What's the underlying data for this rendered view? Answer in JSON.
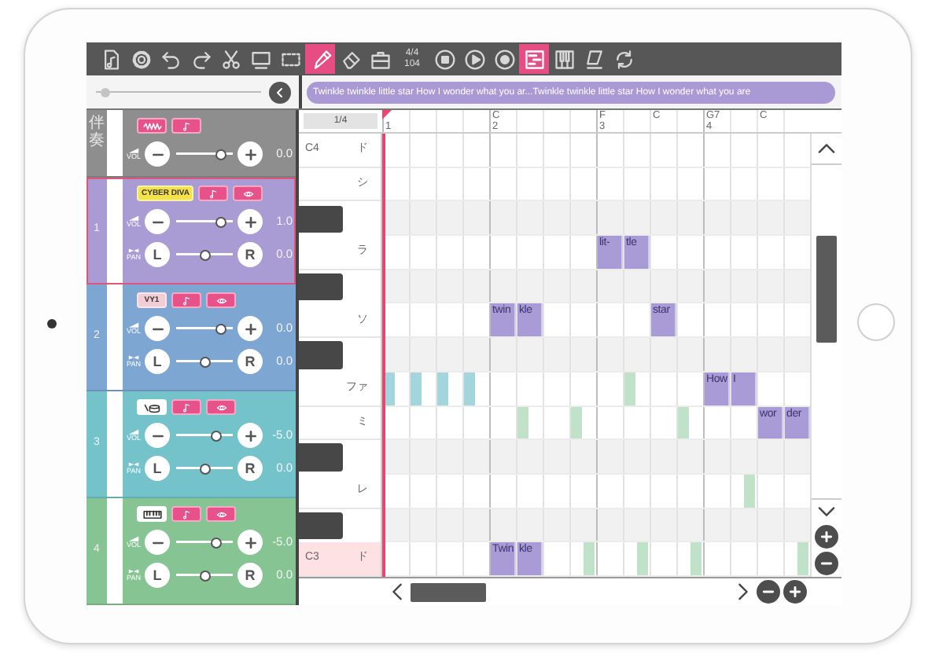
{
  "toolbar": {
    "items": [
      {
        "kind": "file",
        "selected": false
      },
      {
        "kind": "settings",
        "selected": false
      },
      {
        "kind": "undo",
        "selected": false
      },
      {
        "kind": "redo",
        "selected": false
      },
      {
        "kind": "cut",
        "selected": false
      },
      {
        "kind": "select",
        "selected": false
      },
      {
        "kind": "move",
        "selected": false
      },
      {
        "kind": "pencil",
        "selected": true
      },
      {
        "kind": "eraser",
        "selected": false
      },
      {
        "kind": "toolbox",
        "selected": false
      },
      {
        "kind": "tempo",
        "meter": "4/4",
        "tempo": "104"
      },
      {
        "kind": "stop"
      },
      {
        "kind": "play"
      },
      {
        "kind": "record"
      },
      {
        "kind": "pianoroll",
        "selected": true
      },
      {
        "kind": "keyboard",
        "selected": false
      },
      {
        "kind": "score",
        "selected": false
      },
      {
        "kind": "loop",
        "selected": false
      }
    ]
  },
  "zoom_slider": {
    "level": 0.03
  },
  "lyrics": {
    "text": "Twinkle twinkle little star How I wonder what you ar...Twinkle twinkle little star How I wonder what you are"
  },
  "tracks": [
    {
      "label": "伴奏",
      "color": "#8e8e8e",
      "selected": false,
      "badges": [
        {
          "kind": "wave"
        },
        {
          "kind": "note"
        }
      ],
      "controls": [
        {
          "kind": "volume",
          "label": "VOL",
          "level": 0.87,
          "reading": "0.0"
        }
      ]
    },
    {
      "label": "1",
      "color": "#a99bd3",
      "selected": true,
      "badges": [
        {
          "kind": "text",
          "text": "CYBER DIVA",
          "color": "#f3e24c"
        },
        {
          "kind": "note"
        },
        {
          "kind": "eye"
        }
      ],
      "controls": [
        {
          "kind": "volume",
          "label": "VOL",
          "level": 0.87,
          "reading": "1.0"
        },
        {
          "kind": "pan",
          "label": "PAN",
          "left": "L",
          "right": "R",
          "level": 0.5,
          "reading": "0.0"
        }
      ]
    },
    {
      "label": "2",
      "color": "#7ea6d3",
      "selected": false,
      "badges": [
        {
          "kind": "text",
          "text": "VY1",
          "color": "#f3cdd6"
        },
        {
          "kind": "note"
        },
        {
          "kind": "eye"
        }
      ],
      "controls": [
        {
          "kind": "volume",
          "label": "VOL",
          "level": 0.87,
          "reading": "0.0"
        },
        {
          "kind": "pan",
          "label": "PAN",
          "left": "L",
          "right": "R",
          "level": 0.5,
          "reading": "0.0"
        }
      ]
    },
    {
      "label": "3",
      "color": "#74c3cb",
      "selected": false,
      "badges": [
        {
          "kind": "drum"
        },
        {
          "kind": "note"
        },
        {
          "kind": "eye"
        }
      ],
      "controls": [
        {
          "kind": "volume",
          "label": "VOL",
          "level": 0.75,
          "reading": "-5.0"
        },
        {
          "kind": "pan",
          "label": "PAN",
          "left": "L",
          "right": "R",
          "level": 0.5,
          "reading": "0.0"
        }
      ]
    },
    {
      "label": "4",
      "color": "#86c593",
      "selected": false,
      "badges": [
        {
          "kind": "keys"
        },
        {
          "kind": "note"
        },
        {
          "kind": "eye"
        }
      ],
      "controls": [
        {
          "kind": "volume",
          "label": "VOL",
          "level": 0.75,
          "reading": "-5.0"
        },
        {
          "kind": "pan",
          "label": "PAN",
          "left": "L",
          "right": "R",
          "level": 0.5,
          "reading": "0.0"
        }
      ]
    }
  ],
  "editor": {
    "grid_division": "1/4",
    "ruler": [
      {
        "measure": "1"
      },
      {
        "chord": "C",
        "measure": "2"
      },
      {
        "chord": "F",
        "measure": "3"
      },
      {
        "chord": "C"
      },
      {
        "chord": "G7",
        "measure": "4"
      },
      {
        "chord": "C"
      }
    ],
    "pitch_rows": [
      {
        "kind": "white",
        "octave": "C4",
        "label": "ド",
        "selected": false
      },
      {
        "kind": "white",
        "label": "シ",
        "selected": false
      },
      {
        "kind": "black"
      },
      {
        "kind": "white",
        "label": "ラ",
        "selected": false,
        "notes": [
          {
            "kind": "lyric",
            "lyric": "lit-",
            "color": "#a99bd5"
          },
          {
            "kind": "lyric",
            "lyric": "tle",
            "color": "#a99bd5"
          }
        ]
      },
      {
        "kind": "black"
      },
      {
        "kind": "white",
        "label": "ソ",
        "selected": false,
        "notes": [
          {
            "kind": "lyric",
            "lyric": "twin",
            "color": "#a99bd5"
          },
          {
            "kind": "lyric",
            "lyric": "kle",
            "color": "#a99bd5"
          },
          {
            "kind": "lyric",
            "lyric": "star",
            "color": "#a99bd5"
          }
        ]
      },
      {
        "kind": "black"
      },
      {
        "kind": "white",
        "label": "ファ",
        "selected": false,
        "notes": [
          {
            "kind": "bar",
            "color": "#a3d6dc"
          },
          {
            "kind": "bar",
            "color": "#a3d6dc"
          },
          {
            "kind": "bar",
            "color": "#a3d6dc"
          },
          {
            "kind": "bar",
            "color": "#a3d6dc"
          },
          {
            "kind": "bar",
            "color": "#bfe2c8"
          },
          {
            "kind": "lyric",
            "lyric": "How",
            "color": "#a99bd5"
          },
          {
            "kind": "lyric",
            "lyric": "I",
            "color": "#a99bd5"
          }
        ]
      },
      {
        "kind": "white",
        "label": "ミ",
        "selected": false,
        "notes": [
          {
            "kind": "bar",
            "color": "#bfe2c8"
          },
          {
            "kind": "bar",
            "color": "#bfe2c8"
          },
          {
            "kind": "bar",
            "color": "#bfe2c8"
          },
          {
            "kind": "lyric",
            "lyric": "wor",
            "color": "#a99bd5"
          },
          {
            "kind": "lyric",
            "lyric": "der",
            "color": "#a99bd5"
          }
        ]
      },
      {
        "kind": "black"
      },
      {
        "kind": "white",
        "label": "レ",
        "selected": false,
        "notes": [
          {
            "kind": "bar",
            "color": "#bfe2c8"
          }
        ]
      },
      {
        "kind": "black"
      },
      {
        "kind": "white",
        "octave": "C3",
        "label": "ド",
        "selected": true,
        "notes": [
          {
            "kind": "lyric",
            "lyric": "Twin",
            "color": "#a99bd5"
          },
          {
            "kind": "lyric",
            "lyric": "kle",
            "color": "#a99bd5"
          },
          {
            "kind": "bar",
            "color": "#bfe2c8"
          },
          {
            "kind": "bar",
            "color": "#bfe2c8"
          },
          {
            "kind": "bar",
            "color": "#bfe2c8"
          },
          {
            "kind": "bar",
            "color": "#bfe2c8"
          }
        ]
      }
    ]
  }
}
